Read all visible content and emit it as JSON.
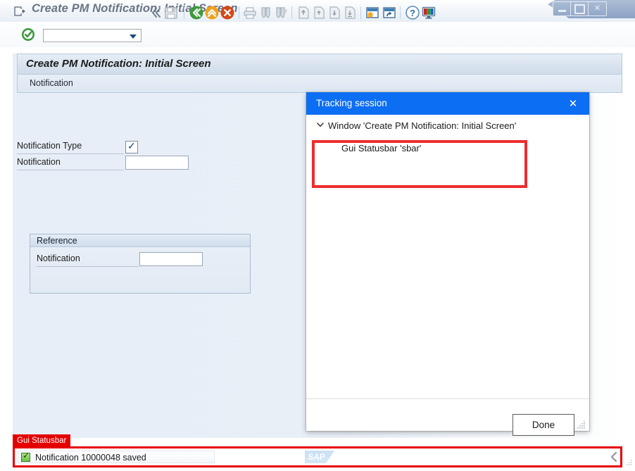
{
  "window": {
    "title": "Create PM Notification: Initial Screen",
    "title_icon": "exit-arrow-icon",
    "controls": {
      "minimize": "minimize-button",
      "maximize": "maximize-button",
      "close": "close-button"
    }
  },
  "toolbar": {
    "ok_button": "green-check-enter-icon",
    "command_field": {
      "value": "",
      "placeholder": ""
    },
    "icons": [
      {
        "name": "menu-chevrons-icon",
        "label": "«"
      },
      {
        "name": "save-icon",
        "label": "Save"
      },
      {
        "name": "back-icon",
        "label": "Back"
      },
      {
        "name": "exit-icon",
        "label": "Exit"
      },
      {
        "name": "cancel-icon",
        "label": "Cancel"
      },
      {
        "name": "print-icon",
        "label": "Print"
      },
      {
        "name": "find-icon",
        "label": "Find"
      },
      {
        "name": "find-next-icon",
        "label": "Find Next"
      },
      {
        "name": "first-page-icon",
        "label": "First Page"
      },
      {
        "name": "previous-page-icon",
        "label": "Previous Page"
      },
      {
        "name": "next-page-icon",
        "label": "Next Page"
      },
      {
        "name": "last-page-icon",
        "label": "Last Page"
      },
      {
        "name": "create-session-icon",
        "label": "Create Session"
      },
      {
        "name": "create-shortcut-icon",
        "label": "Create Shortcut"
      },
      {
        "name": "help-icon",
        "label": "Help"
      },
      {
        "name": "customize-local-layout-icon",
        "label": "Customize Local Layout"
      }
    ]
  },
  "screen": {
    "title": "Create PM Notification: Initial Screen",
    "section_header": "Notification",
    "fields": [
      {
        "name": "notification-type",
        "label": "Notification Type",
        "control": "checkbox-valuehelp",
        "value": ""
      },
      {
        "name": "notification-number",
        "label": "Notification",
        "control": "input",
        "value": ""
      }
    ],
    "reference_group": {
      "title": "Reference",
      "fields": [
        {
          "name": "reference-notification",
          "label": "Notification",
          "control": "input",
          "value": ""
        }
      ]
    }
  },
  "dialog": {
    "title": "Tracking session",
    "close_icon": "close-icon",
    "tree": {
      "expand_icon": "chevron-down-icon",
      "nodes": [
        {
          "label": "Window 'Create PM Notification: Initial Screen'",
          "level": 0
        },
        {
          "label": "Gui Statusbar 'sbar'",
          "level": 1
        }
      ]
    },
    "done_label": "Done",
    "resize_grip": "resize-grip-icon"
  },
  "statusbar": {
    "annotation_tag": "Gui Statusbar",
    "message": "Notification 10000048 saved",
    "status_icon": "green-check-success-icon",
    "brand_logo": "sap-logo",
    "expand_icon": "statusbar-expand-arrow-icon"
  },
  "colors": {
    "dialog_title_blue": "#0c6ef2",
    "highlight_red": "#ed2d2d",
    "statusbar_red": "#e50000",
    "success_green": "#6ec24a",
    "sap_blue": "#cfe4f5"
  }
}
